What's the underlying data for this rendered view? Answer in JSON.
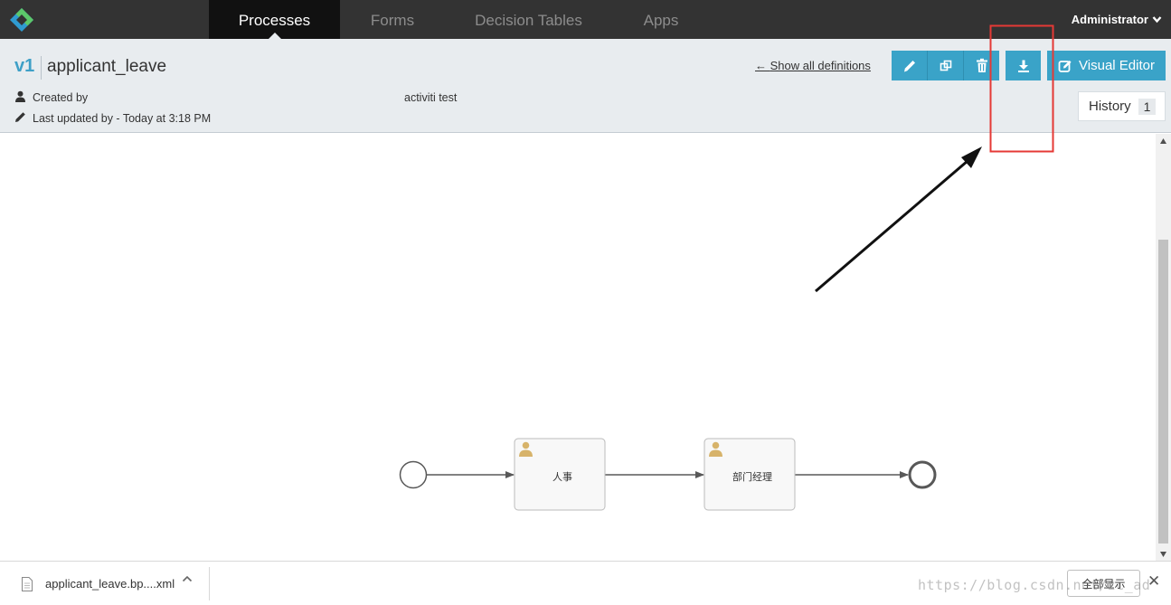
{
  "nav": {
    "tabs": [
      {
        "label": "Processes",
        "active": true
      },
      {
        "label": "Forms",
        "active": false
      },
      {
        "label": "Decision Tables",
        "active": false
      },
      {
        "label": "Apps",
        "active": false
      }
    ],
    "user": "Administrator"
  },
  "definition": {
    "version": "v1",
    "name": "applicant_leave",
    "created_by_label": "Created by",
    "created_by_value": "activiti test",
    "last_updated": "Last updated by - Today at 3:18 PM",
    "show_all_link": "Show all definitions",
    "show_all_arrow": "←",
    "visual_editor_label": "Visual Editor",
    "history_label": "History",
    "history_count": "1"
  },
  "diagram": {
    "tasks": [
      "人事",
      "部门经理"
    ]
  },
  "downloads": {
    "file_name": "applicant_leave.bp....xml",
    "show_all": "全部显示",
    "close": "✕",
    "watermark": "https://blog.csdn.net/zc_ad"
  },
  "colors": {
    "nav_bg": "#333333",
    "nav_active": "#111111",
    "header_bg": "#e8ecef",
    "accent": "#3aa3c8",
    "annotation_red": "#e53935"
  },
  "icons": {
    "edit": "pencil-icon",
    "copy": "copy-icon",
    "delete": "trash-icon",
    "download": "download-icon",
    "visual_editor": "edit-square-icon",
    "user_task": "user-icon"
  }
}
